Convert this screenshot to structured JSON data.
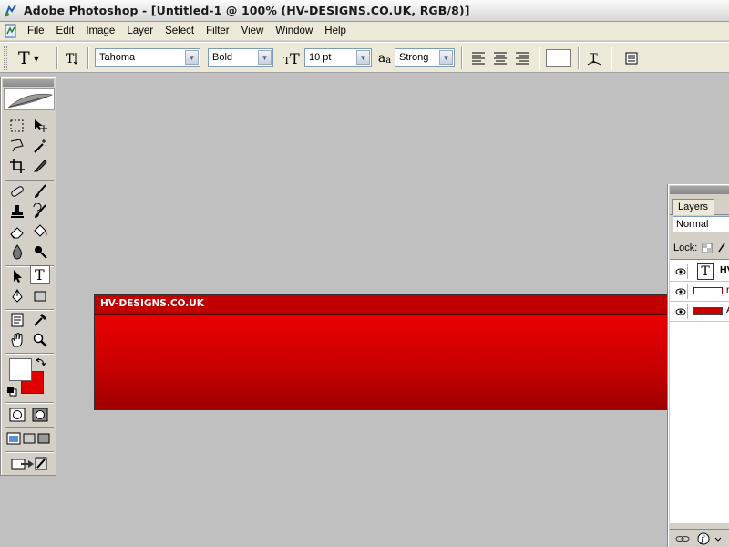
{
  "window": {
    "title": "Adobe Photoshop - [Untitled-1 @ 100% (HV-DESIGNS.CO.UK, RGB/8)]"
  },
  "menu": [
    "File",
    "Edit",
    "Image",
    "Layer",
    "Select",
    "Filter",
    "View",
    "Window",
    "Help"
  ],
  "options": {
    "font_family": "Tahoma",
    "font_style": "Bold",
    "font_size": "10 pt",
    "antialias_label": "a",
    "antialias_sub": "a",
    "antialias": "Strong"
  },
  "colors": {
    "foreground": "#e00000",
    "background": "#ffffff",
    "banner": "#d40000"
  },
  "canvas": {
    "banner_text": "HV-DESIGNS.CO.UK"
  },
  "layers_panel": {
    "tab": "Layers",
    "blend_mode": "Normal",
    "lock_label": "Lock:",
    "layers": [
      {
        "name": "HV",
        "kind": "text"
      },
      {
        "name": "r",
        "kind": "image-outline"
      },
      {
        "name": "A",
        "kind": "image-fill"
      }
    ]
  }
}
